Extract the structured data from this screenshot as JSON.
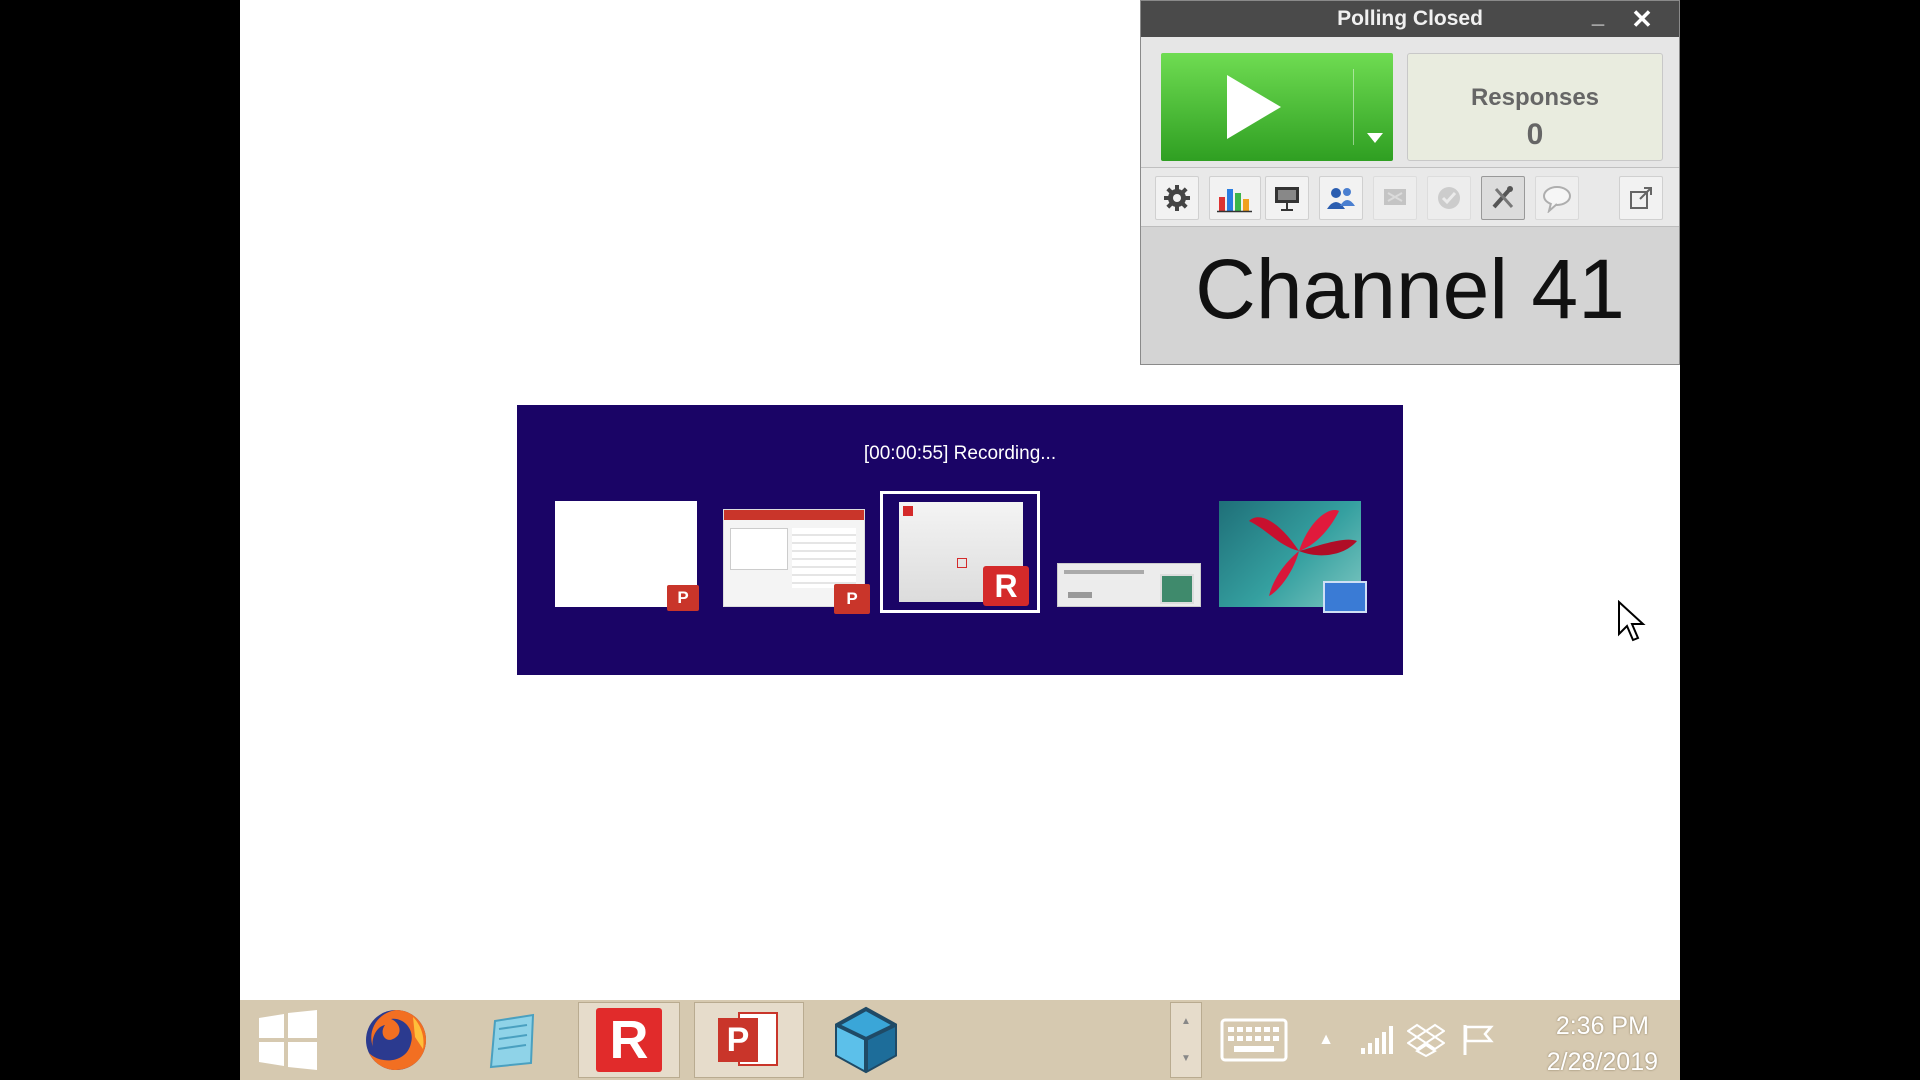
{
  "poll": {
    "title": "Polling Closed",
    "min_glyph": "_",
    "close_glyph": "✕",
    "start_button_label": "Start polling",
    "responses_label": "Responses",
    "responses_count": "0",
    "toolbar_icons": [
      "gear-icon",
      "bar-chart-icon",
      "presentation-icon",
      "participants-icon",
      "screen-icon",
      "check-icon",
      "tools-icon",
      "speech-bubble-icon",
      "popout-icon"
    ],
    "channel_text": "Channel 41",
    "accent_green": "#3eb82e"
  },
  "switcher": {
    "status": "[00:00:55] Recording...",
    "bg_color": "#1a0466",
    "items": [
      {
        "app": "PowerPoint",
        "badge": "P"
      },
      {
        "app": "PowerPoint",
        "badge": "P"
      },
      {
        "app": "Responses",
        "badge": "R",
        "selected": true
      },
      {
        "app": "Dialog",
        "badge": ""
      },
      {
        "app": "Desktop",
        "badge": ""
      }
    ]
  },
  "taskbar": {
    "apps": [
      {
        "name": "start",
        "icon": "windows-logo-icon"
      },
      {
        "name": "firefox",
        "icon": "firefox-icon"
      },
      {
        "name": "notepad",
        "icon": "notepad-icon"
      },
      {
        "name": "responseware",
        "icon": "r-logo-icon",
        "label": "R"
      },
      {
        "name": "powerpoint",
        "icon": "powerpoint-icon",
        "label": "P"
      },
      {
        "name": "cube-app",
        "icon": "cube-icon"
      }
    ],
    "tray_icons": [
      "keyboard-icon",
      "show-hidden-icons-icon",
      "signal-icon",
      "dropbox-icon",
      "flag-icon"
    ],
    "time": "2:36 PM",
    "date": "2/28/2019"
  }
}
